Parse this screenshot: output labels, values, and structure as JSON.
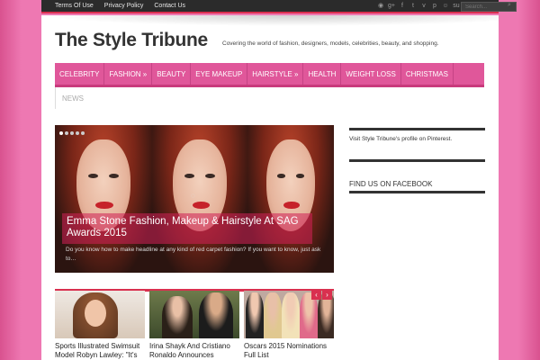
{
  "topbar": {
    "links": [
      "Terms Of Use",
      "Privacy Policy",
      "Contact Us"
    ],
    "social_icons": [
      "rss-icon",
      "google-plus-icon",
      "facebook-icon",
      "twitter-icon",
      "vimeo-icon",
      "pinterest-icon",
      "reddit-icon",
      "stumbleupon-icon"
    ],
    "search_placeholder": "Search..."
  },
  "header": {
    "title": "The Style Tribune",
    "tagline": "Covering the world of fashion, designers, models, celebrities, beauty, and shopping."
  },
  "nav": {
    "items": [
      "CELEBRITY",
      "FASHION »",
      "BEAUTY",
      "EYE MAKEUP",
      "HAIRSTYLE »",
      "HEALTH",
      "WEIGHT LOSS",
      "CHRISTMAS"
    ],
    "second_row": [
      "NEWS"
    ]
  },
  "slider": {
    "dots": 5,
    "active_dot": 0,
    "caption_title": "Emma Stone Fashion, Makeup & Hairstyle At SAG Awards 2015",
    "excerpt": "Do you know how to make headline at any kind of red carpet fashion? If you want to know, just ask to…"
  },
  "sidebar": {
    "pinterest_text": "Visit Style Tribune's profile on Pinterest.",
    "facebook_heading": "FIND US ON FACEBOOK"
  },
  "posts": [
    {
      "title": "Sports Illustrated Swimsuit Model Robyn Lawley: \"It's"
    },
    {
      "title": "Irina Shayk And Cristiano Ronaldo Announces"
    },
    {
      "title": "Oscars 2015 Nominations Full List"
    }
  ],
  "carousel_arrows": [
    "‹",
    "›"
  ],
  "colors": {
    "accent": "#d9304f",
    "nav": "#e0579a",
    "background": "#e2629f"
  }
}
